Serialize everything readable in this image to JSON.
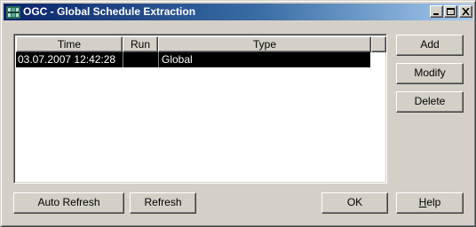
{
  "window": {
    "title": "OGC - Global Schedule Extraction"
  },
  "list": {
    "columns": [
      "Time",
      "Run",
      "Type",
      ""
    ],
    "rows": [
      {
        "time": "03.07.2007 12:42:28",
        "run": "",
        "type": "Global",
        "selected": true
      }
    ]
  },
  "buttons": {
    "add": "Add",
    "modify": "Modify",
    "delete": "Delete",
    "auto_refresh": "Auto Refresh",
    "refresh": "Refresh",
    "ok": "OK",
    "help_first": "H",
    "help_rest": "elp"
  },
  "colors": {
    "face": "#d4d0c8",
    "titlebar_start": "#0a246a",
    "titlebar_end": "#a6caf0",
    "selection": "#000000"
  },
  "icons": {
    "app": "app-icon",
    "minimize": "minimize-icon",
    "maximize": "maximize-icon",
    "close": "close-icon"
  }
}
